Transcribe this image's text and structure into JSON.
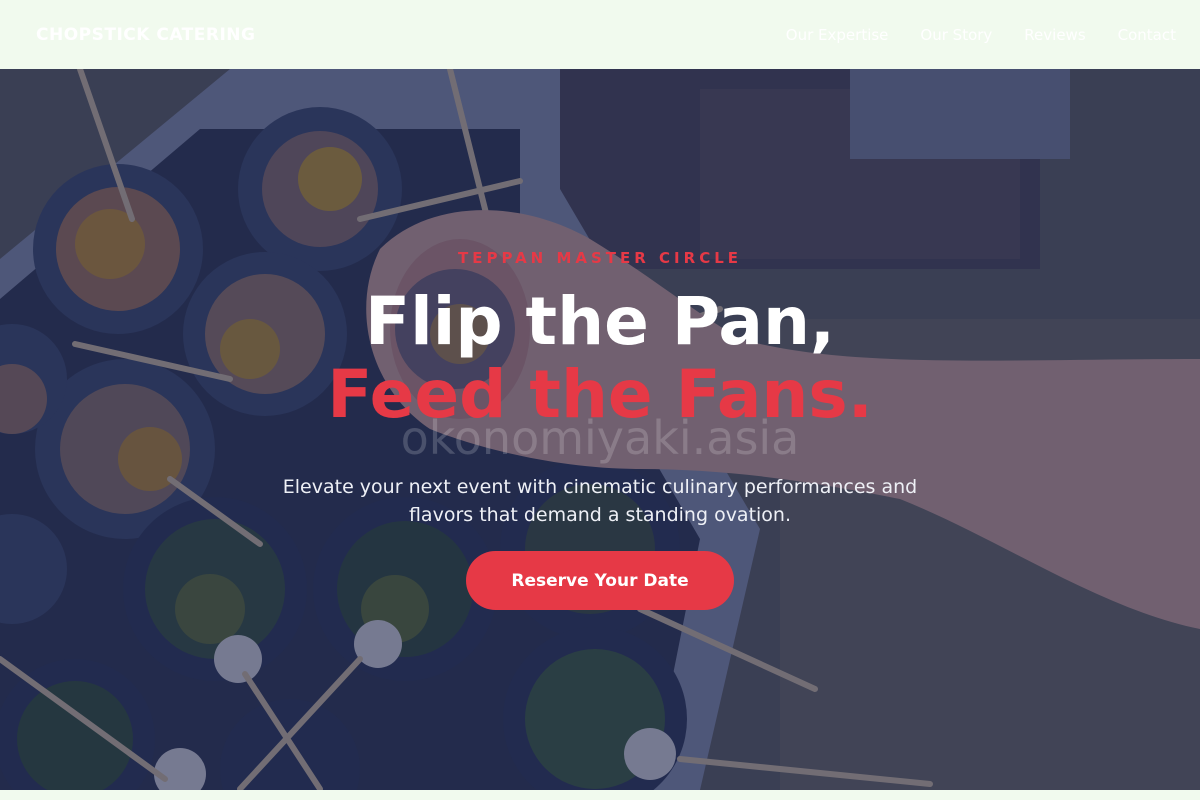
{
  "navbar": {
    "brand": "CHOPSTICK CATERING",
    "links": [
      "Our Expertise",
      "Our Story",
      "Reviews",
      "Contact"
    ]
  },
  "hero": {
    "eyebrow": "TEPPAN MASTER CIRCLE",
    "title_line1": "Flip the Pan,",
    "title_line2": "Feed the Fans.",
    "watermark": "okonomiyaki.asia",
    "subtitle": "Elevate your next event with cinematic culinary performances and flavors that demand a standing ovation.",
    "cta_label": "Reserve Your Date"
  },
  "colors": {
    "accent": "#e63946",
    "nav_background": "#f1faee",
    "overlay": "#1d284e"
  }
}
